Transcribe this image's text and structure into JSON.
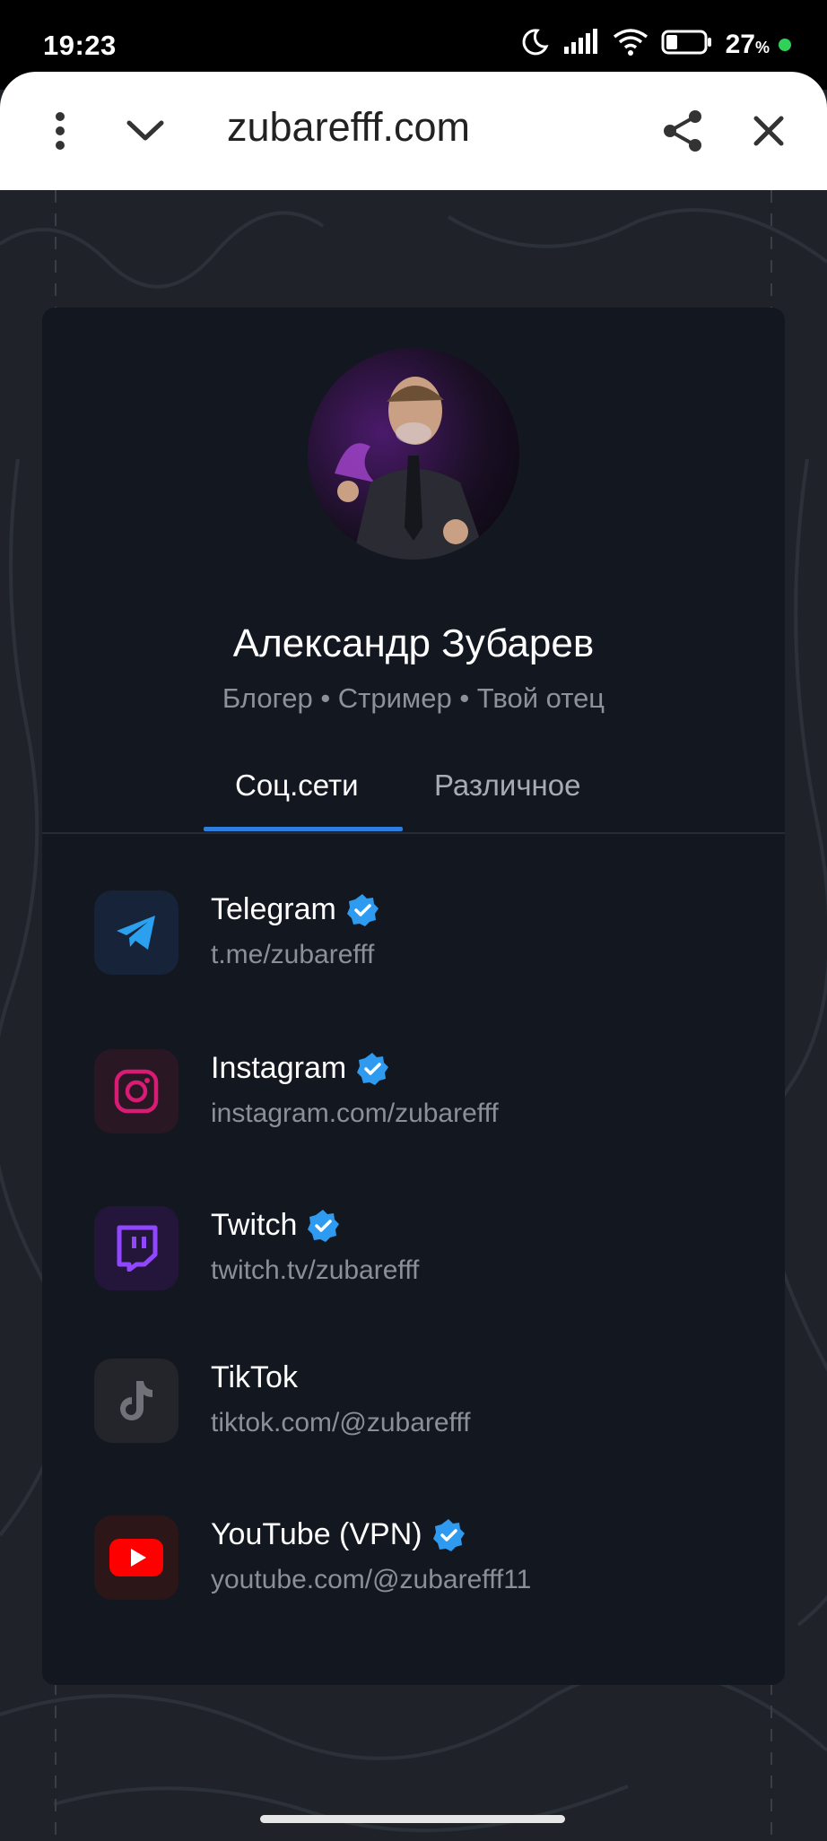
{
  "status_bar": {
    "time": "19:23",
    "battery_percent": "27",
    "battery_unit": "%",
    "icons": [
      "moon-icon",
      "signal-icon",
      "wifi-icon",
      "battery-icon"
    ]
  },
  "browser": {
    "url": "zubarefff.com",
    "icons": [
      "more-vert-icon",
      "chevron-down-icon",
      "share-icon",
      "close-icon"
    ]
  },
  "profile": {
    "name": "Александр Зубарев",
    "subtitle": "Блогер • Стример • Твой отец"
  },
  "tabs": [
    {
      "label": "Соц.сети",
      "active": true
    },
    {
      "label": "Различное",
      "active": false
    }
  ],
  "links": [
    {
      "title": "Telegram",
      "url": "t.me/zubarefff",
      "verified": true,
      "icon": "telegram-icon",
      "color": "#2aa0ee"
    },
    {
      "title": "Instagram",
      "url": "instagram.com/zubarefff",
      "verified": true,
      "icon": "instagram-icon",
      "color": "#d81b74"
    },
    {
      "title": "Twitch",
      "url": "twitch.tv/zubarefff",
      "verified": true,
      "icon": "twitch-icon",
      "color": "#9146ff"
    },
    {
      "title": "TikTok",
      "url": "tiktok.com/@zubarefff",
      "verified": false,
      "icon": "tiktok-icon",
      "color": "#6f7278"
    },
    {
      "title": "YouTube (VPN)",
      "url": "youtube.com/@zubarefff11",
      "verified": true,
      "icon": "youtube-icon",
      "color": "#ff0000"
    }
  ],
  "colors": {
    "background": "#1f2329",
    "card": "#131720",
    "accent": "#2b7fe0",
    "verified_badge": "#2f9bf0"
  }
}
